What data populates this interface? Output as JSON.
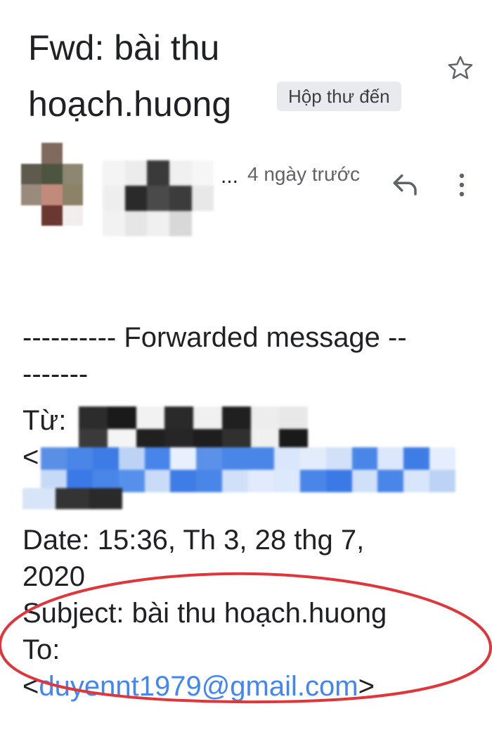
{
  "email": {
    "subject_line1": "Fwd: bài thu",
    "subject_line2": "hoạch.huong",
    "label": "Hộp thư đến",
    "sender_ellipsis": "...",
    "time": "4 ngày trước"
  },
  "icons": {
    "star": "star-outline-icon",
    "reply": "reply-icon",
    "more": "more-vert-icon"
  },
  "message": {
    "forward_header_line1": "---------- Forwarded message --",
    "forward_header_line2": "-------",
    "from_label": "Từ:",
    "from_bracket": "<",
    "date_line1": "Date: 15:36, Th 3, 28 thg 7,",
    "date_line2": "2020",
    "subject_line": "Subject: bài thu hoạch.huong",
    "to_label": "To:",
    "to_open": "<",
    "to_email": "duyennt1979@gmail.com",
    "to_close": ">"
  },
  "colors": {
    "link": "#4285f4",
    "annotation": "#e0353b",
    "chip_bg": "#e8eaed"
  }
}
